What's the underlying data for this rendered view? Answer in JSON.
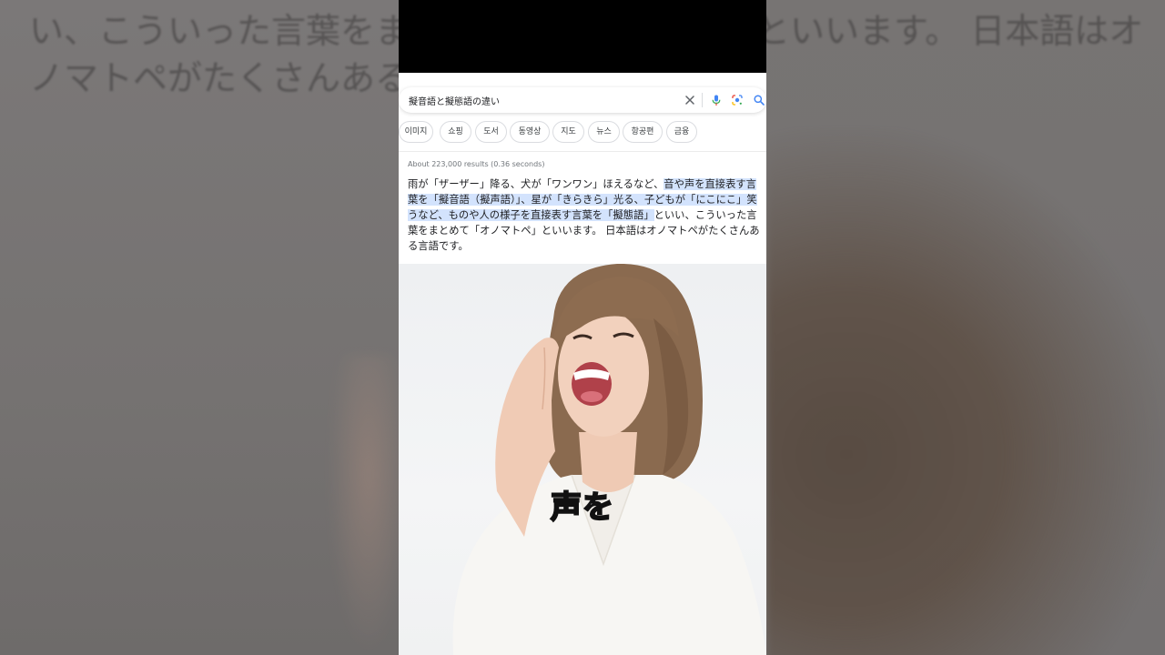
{
  "background": {
    "text": "い、こういった言葉をまとめて「オノマトペ」といいます。 日本語はオノマトペがたくさんある言語です。"
  },
  "search": {
    "query": "擬音語と擬態語の違い",
    "icons": [
      "close-icon",
      "mic-icon",
      "lens-icon",
      "search-icon"
    ]
  },
  "chips": [
    "이미지",
    "쇼핑",
    "도서",
    "동영상",
    "지도",
    "뉴스",
    "항공편",
    "금융"
  ],
  "results": {
    "stats": "About 223,000 results (0.36 seconds)",
    "snippet_plain_1": "雨が「ザーザー」降る、犬が「ワンワン」ほえるなど、",
    "snippet_highlight": "音や声を直接表す言葉を「擬音語（擬声語）」、星が「きらきら」光る、子どもが「にこにこ」笑うなど、ものや人の様子を直接表す言葉を「擬態語」",
    "snippet_plain_2": "といい、こういった言葉をまとめて「オノマトペ」といいます。 日本語はオノマトペがたくさんある言語です。"
  },
  "caption": "声を",
  "colors": {
    "highlight": "#d3e3fd",
    "mic_blue": "#4285f4",
    "mic_red": "#ea4335",
    "hair": "#8a6a4f",
    "skin": "#f0cdb9"
  }
}
